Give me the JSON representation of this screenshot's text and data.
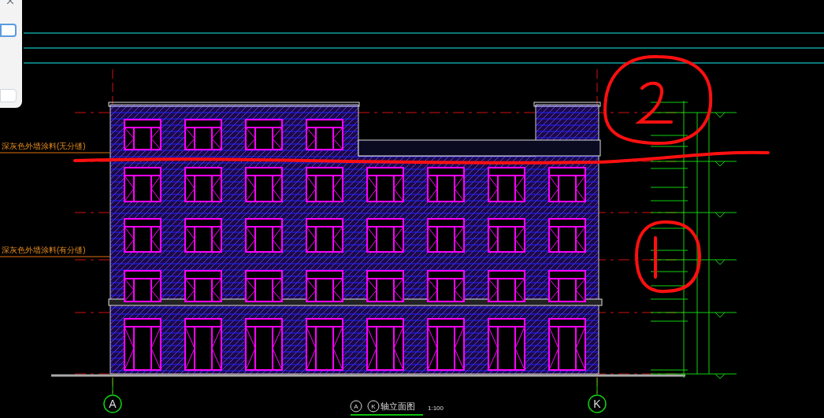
{
  "dialog": {
    "fields": [
      {
        "focused": true
      },
      {
        "focused": false
      }
    ]
  },
  "legend_labels": [
    "深灰色外墙涂料(无分缝)",
    "深灰色外墙涂料(有分缝)"
  ],
  "axes": [
    {
      "label": "A"
    },
    {
      "label": "K"
    }
  ],
  "title": {
    "from": "A",
    "to": "K",
    "text": "轴立面图",
    "scale": "1:100"
  }
}
